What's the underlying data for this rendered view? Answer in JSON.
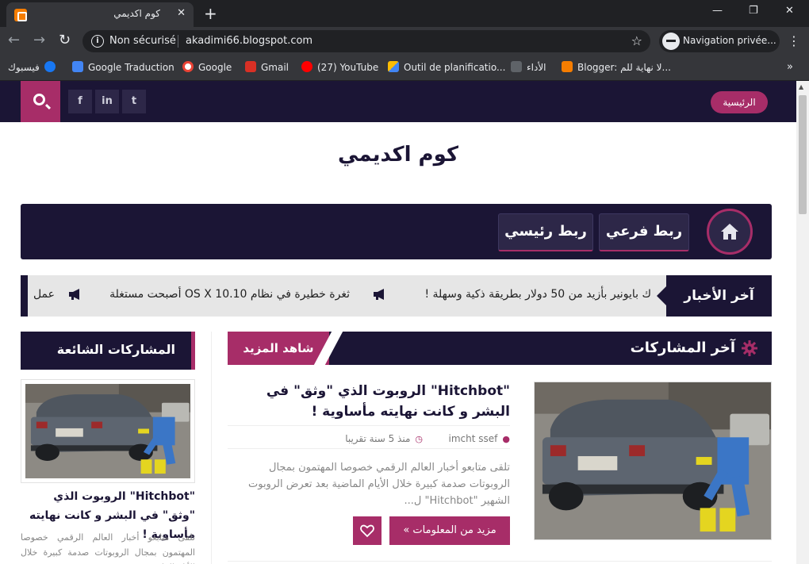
{
  "browser": {
    "tab_title": "كوم اكديمي",
    "tab_close": "✕",
    "new_tab": "+",
    "win_min": "—",
    "win_max": "❐",
    "win_close": "✕",
    "security_label": "Non sécurisé",
    "url": "akadimi66.blogspot.com",
    "incognito_label": "Navigation privée...",
    "bookmarks": [
      {
        "label": "فيسبوك",
        "icon": "facebook-icon",
        "color": "#1877f2"
      },
      {
        "label": "Google Traduction",
        "icon": "translate-icon",
        "color": "#4285f4"
      },
      {
        "label": "Google",
        "icon": "google-icon",
        "color": "#ea4335"
      },
      {
        "label": "Gmail",
        "icon": "gmail-icon",
        "color": "#d93025"
      },
      {
        "label": "(27) YouTube",
        "icon": "youtube-icon",
        "color": "#ff0000"
      },
      {
        "label": "Outil de planificatio...",
        "icon": "ads-icon",
        "color": "#fbbc04"
      },
      {
        "label": "الأداء",
        "icon": "performance-icon",
        "color": "#5f6368"
      },
      {
        "label": "Blogger: لا نهاية للم...",
        "icon": "blogger-icon",
        "color": "#f57d00"
      }
    ],
    "more_bookmarks": "»"
  },
  "site": {
    "home_pill": "الرئيسية",
    "social": [
      "f",
      "in",
      "t"
    ],
    "title": "كوم اكديمي",
    "menu": {
      "item1": "ربط فرعي",
      "item2": "ربط رئيسي"
    },
    "ticker": {
      "label": "آخر الأخبار",
      "items": [
        "ك بايونير بأزيد من 50 دولار بطريقة ذكية وسهلة !",
        "ثغرة خطيرة في نظام OS X 10.10 أصبحت مستغلة",
        "عمل"
      ]
    },
    "main_section": {
      "title": "آخر المشاركات",
      "more": "شاهد المزيد"
    },
    "post": {
      "title": "\"Hitchbot\" الروبوت الذي \"وثق\" في البشر و كانت نهايته مأساوية !",
      "author": "imcht ssef",
      "date": "منذ 5 سنة تقريبا",
      "excerpt": "تلقى متابعو أخبار العالم الرقمي خصوصا المهتمون بمجال الروبوتات صدمة كبيرة خلال الأيام الماضية بعد تعرض الروبوت الشهير \"Hitchbot\" ل...",
      "read_more": "مزيد من المعلومات »"
    },
    "sidebar": {
      "title": "المشاركات الشائعة",
      "post_title": "\"Hitchbot\" الروبوت الذي \"وثق\" في البشر و كانت نهايته مأساوية !",
      "post_excerpt": "تلقى متابعو أخبار العالم الرقمي خصوصا المهتمون بمجال الروبوتات صدمة كبيرة خلال الأيام الماضية بعد تعرض"
    },
    "colors": {
      "navy": "#1b1535",
      "accent": "#a72d68"
    }
  }
}
